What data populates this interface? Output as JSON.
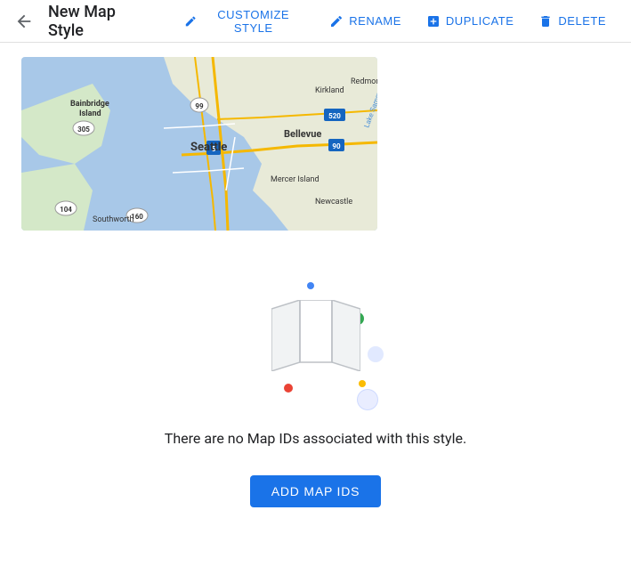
{
  "header": {
    "back_label": "←",
    "title": "New Map Style",
    "actions": [
      {
        "id": "customize",
        "label": "CUSTOMIZE STYLE",
        "icon": "pencil-ruler-icon"
      },
      {
        "id": "rename",
        "label": "RENAME",
        "icon": "pencil-icon"
      },
      {
        "id": "duplicate",
        "label": "DUPLICATE",
        "icon": "copy-icon"
      },
      {
        "id": "delete",
        "label": "DELETE",
        "icon": "trash-icon"
      }
    ]
  },
  "empty_state": {
    "message": "There are no Map IDs associated with this style.",
    "button_label": "ADD MAP IDS"
  },
  "colors": {
    "primary": "#1a73e8",
    "dot_blue": "#4285f4",
    "dot_green": "#34a853",
    "dot_red": "#ea4335",
    "dot_yellow": "#fbbc04",
    "dot_light_blue": "#aecbfa"
  }
}
